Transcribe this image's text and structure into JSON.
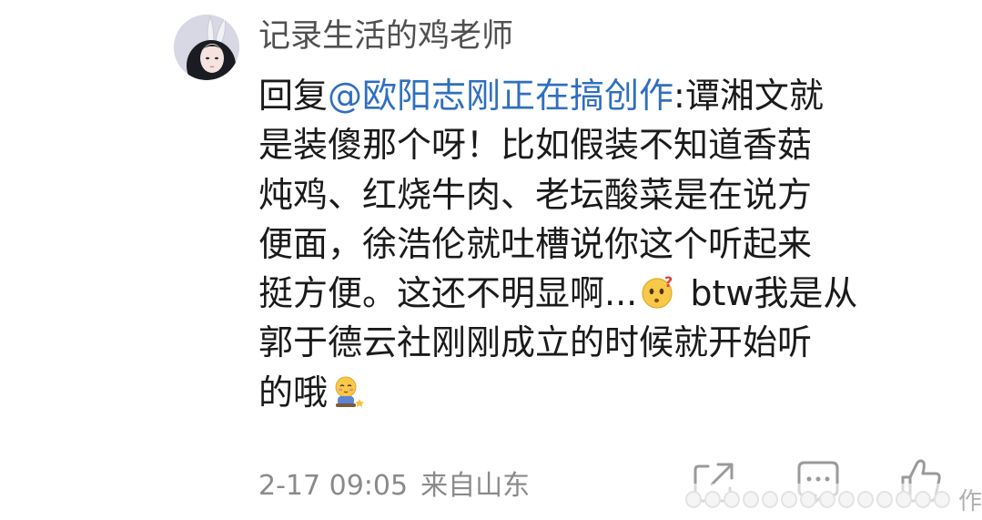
{
  "comment": {
    "username": "记录生活的鸡老师",
    "reply_prefix": "回复",
    "mention": "@欧阳志刚正在搞创作",
    "text_lines": [
      ":谭湘文就",
      "是装傻那个呀！比如假装不知道香菇",
      "炖鸡、红烧牛肉、老坛酸菜是在说方",
      "便面，徐浩伦就吐槽说你这个听起来",
      "挺方便。这还不明显啊...",
      " btw我是从",
      "郭于德云社刚刚成立的时候就开始听",
      "的哦"
    ],
    "emojis": [
      "doubt-emoji",
      "shy-emoji"
    ],
    "timestamp": "2-17 09:05",
    "source": "来自山东"
  },
  "actions": [
    {
      "name": "share",
      "icon": "share-icon"
    },
    {
      "name": "comment",
      "icon": "comment-icon"
    },
    {
      "name": "like",
      "icon": "thumbs-up-icon"
    }
  ],
  "watermark": {
    "trailing_char": "作"
  },
  "colors": {
    "text": "#1a1a1a",
    "username": "#505050",
    "mention": "#2f6fbf",
    "meta": "#8a8a8a",
    "icon": "#9a9a9a"
  }
}
